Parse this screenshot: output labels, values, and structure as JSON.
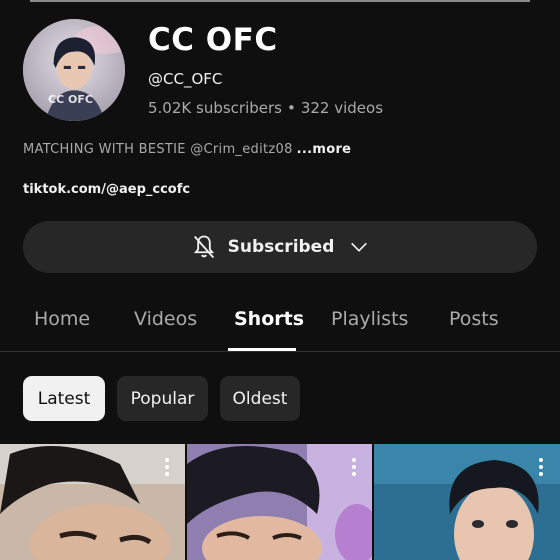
{
  "channel": {
    "name": "CC OFC",
    "handle": "@CC_OFC",
    "subscribers": "5.02K subscribers",
    "separator": "•",
    "videos": "322 videos",
    "avatar_watermark": "CC OFC",
    "description": "MATCHING WITH BESTIE @Crim_editz08",
    "more_label": "...more",
    "link": "tiktok.com/@aep_ccofc"
  },
  "subscribe": {
    "label": "Subscribed",
    "bell_icon": "bell-off-icon",
    "chevron_icon": "chevron-down-icon"
  },
  "tabs": [
    {
      "label": "Home",
      "active": false
    },
    {
      "label": "Videos",
      "active": false
    },
    {
      "label": "Shorts",
      "active": true
    },
    {
      "label": "Playlists",
      "active": false
    },
    {
      "label": "Posts",
      "active": false
    }
  ],
  "filters": [
    {
      "label": "Latest",
      "selected": true
    },
    {
      "label": "Popular",
      "selected": false
    },
    {
      "label": "Oldest",
      "selected": false
    }
  ],
  "colors": {
    "background": "#0f0f0f",
    "button_bg": "#272727",
    "text_primary": "#f1f1f1",
    "text_secondary": "#aaaaaa"
  },
  "shorts": [
    {
      "menu_icon": "more-vert-icon"
    },
    {
      "menu_icon": "more-vert-icon"
    },
    {
      "menu_icon": "more-vert-icon"
    }
  ]
}
